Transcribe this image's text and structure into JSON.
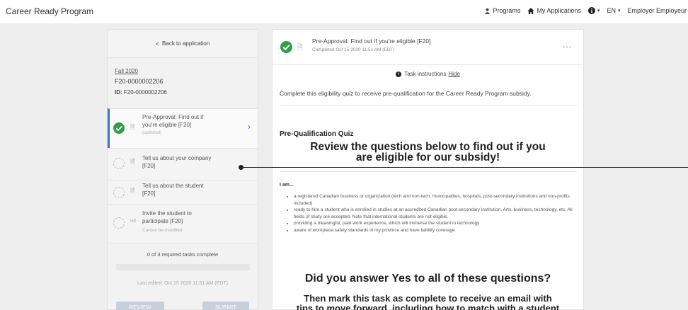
{
  "app": {
    "title": "Career Ready Program"
  },
  "nav": {
    "programs": "Programs",
    "my_applications": "My Applications",
    "language": "EN",
    "user": "Employer Employeur"
  },
  "left": {
    "back_label": "Back to application",
    "term": "Fall 2020",
    "app_number": "F20-0000002206",
    "id_label": "ID:",
    "id_value": "F20-0000002206",
    "tasks": [
      {
        "label_line1": "Pre-Approval: Find out if",
        "label_line2": "you're eligible [F20]",
        "sub": "(optional)",
        "status": "complete"
      },
      {
        "label_line1": "Tell us about your company",
        "label_line2": "[F20]",
        "sub": "",
        "status": "pending"
      },
      {
        "label_line1": "Tell us about the student",
        "label_line2": "[F20]",
        "sub": "",
        "status": "pending"
      },
      {
        "label_line1": "Invite the student to",
        "label_line2": "participate [F20]",
        "sub": "Cannot be modified",
        "status": "pending"
      }
    ],
    "progress_text": "0 of 3 required tasks complete",
    "progress_fraction": 0,
    "last_edited": "Last edited: Oct 15 2020 11:51 AM (EDT)",
    "review_label": "REVIEW",
    "submit_label": "SUBMIT"
  },
  "right": {
    "title": "Pre-Approval: Find out if you're eligible [F20]",
    "completed": "Completed Oct 15 2020 11:51 AM (EDT)",
    "more": "...",
    "instructions_label": "Task instructions",
    "hide_label": "Hide",
    "intro": "Complete this eligibility quiz to receive pre-qualification for the Career Ready Program subsidy.",
    "quiz_title": "Pre-Qualification Quiz",
    "headline_line1": "Review the questions below to find out if you",
    "headline_line2": "are eligible for our subsidy!",
    "iam": "I am...",
    "requirements": [
      "a registered Canadian business or organization (tech and non-tech, municipalities, hospitals, post-secondary institutions and non-profits included)",
      "ready to hire a student who is enrolled in studies at an accredited Canadian post-secondary institution. Arts, business, technology, etc. All fields of study are accepted. Note that international students are not eligible.",
      "providing a meaningful, paid work experience, which will immerse the student in technology",
      "aware of workplace safety standards in my province and have liability coverage"
    ],
    "question": "Did you answer Yes to all of these questions?",
    "followup_line1": "Then mark this task as complete to receive an email with",
    "followup_line2": "tips to move forward, including how to match with a student"
  },
  "colors": {
    "accent": "#3a73c5",
    "success": "#2e9e48"
  }
}
